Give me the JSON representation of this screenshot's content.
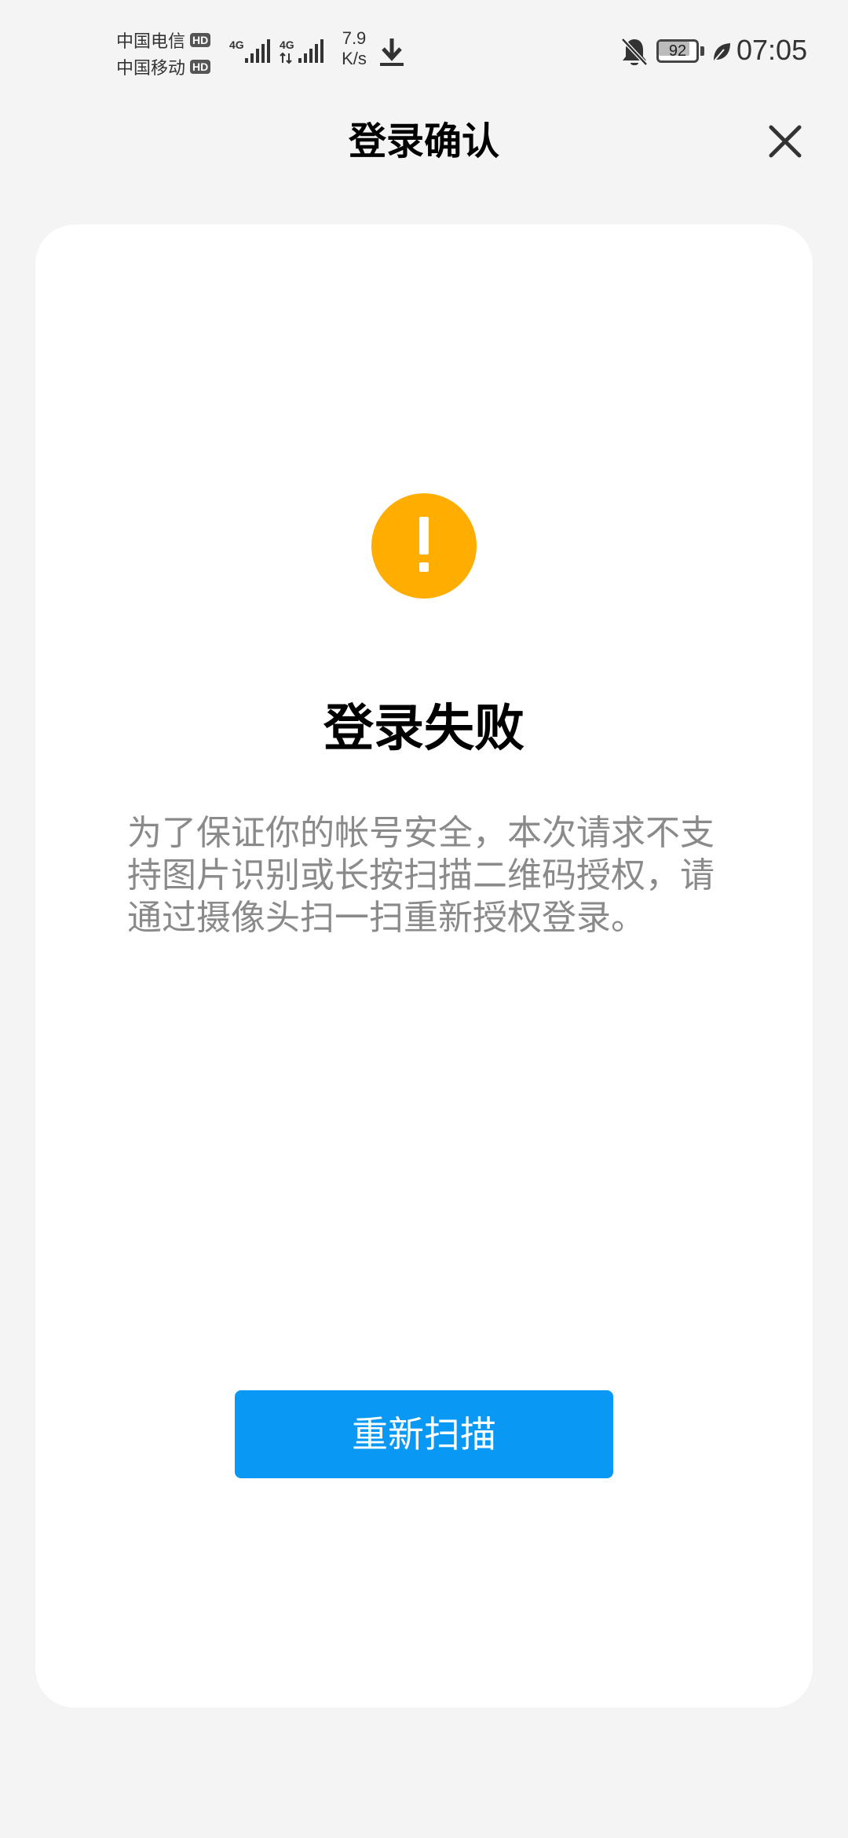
{
  "status_bar": {
    "carriers": [
      {
        "name": "中国电信",
        "badge": "HD"
      },
      {
        "name": "中国移动",
        "badge": "HD"
      }
    ],
    "network_type_1": "4G",
    "network_type_2": "4G",
    "net_speed_value": "7.9",
    "net_speed_unit": "K/s",
    "battery_level": "92",
    "battery_fraction": 0.92,
    "time": "07:05"
  },
  "header": {
    "title": "登录确认",
    "close_icon": "close-icon"
  },
  "result": {
    "icon": "warning-icon",
    "icon_color": "#ffad00",
    "title": "登录失败",
    "message": "为了保证你的帐号安全，本次请求不支持图片识别或长按扫描二维码授权，请通过摄像头扫一扫重新授权登录。"
  },
  "actions": {
    "rescan_label": "重新扫描",
    "rescan_color": "#0a98f5"
  }
}
